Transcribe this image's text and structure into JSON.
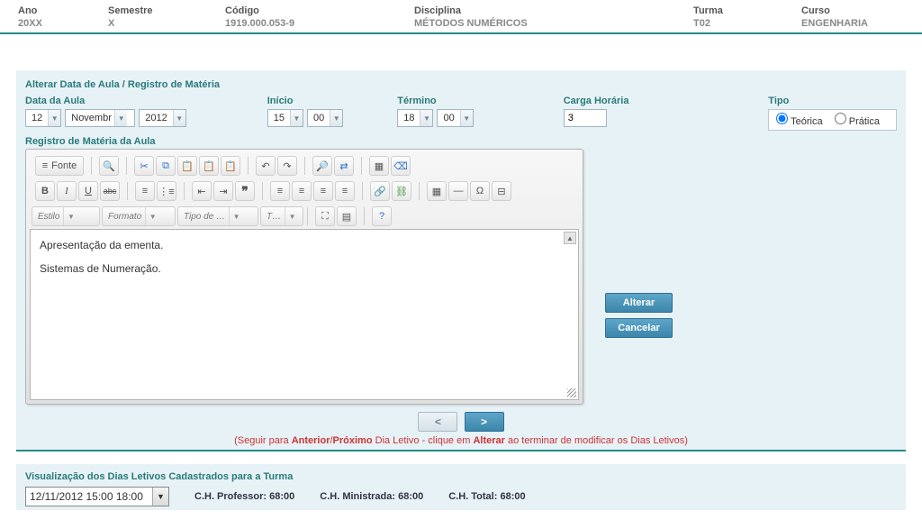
{
  "header": {
    "cols": [
      {
        "label": "Ano",
        "value": "20XX"
      },
      {
        "label": "Semestre",
        "value": "X"
      },
      {
        "label": "Código",
        "value": "1919.000.053-9"
      },
      {
        "label": "Disciplina",
        "value": "MÉTODOS NUMÉRICOS"
      },
      {
        "label": "Turma",
        "value": "T02"
      },
      {
        "label": "Curso",
        "value": "ENGENHARIA"
      }
    ]
  },
  "form": {
    "title": "Alterar Data de Aula / Registro de Matéria",
    "data_aula_label": "Data da Aula",
    "data_aula": {
      "dia": "12",
      "mes": "Novembr",
      "ano": "2012"
    },
    "inicio_label": "Início",
    "inicio": {
      "h": "15",
      "m": "00"
    },
    "termino_label": "Término",
    "termino": {
      "h": "18",
      "m": "00"
    },
    "carga_label": "Carga Horária",
    "carga_value": "3",
    "tipo_label": "Tipo",
    "tipo_teorica": "Teórica",
    "tipo_pratica": "Prática"
  },
  "editor": {
    "section_label": "Registro de Matéria da Aula",
    "source_btn": "Fonte",
    "style_combo": "Estilo",
    "format_combo": "Formato",
    "font_combo": "Tipo de …",
    "size_combo": "T…",
    "content_line1": "Apresentação da ementa.",
    "content_line2": "Sistemas de Numeração."
  },
  "actions": {
    "alterar": "Alterar",
    "cancelar": "Cancelar",
    "prev": "<",
    "next": ">",
    "hint_pre": "(Seguir para ",
    "hint_ant": "Anterior",
    "hint_sep": "/",
    "hint_prox": "Próximo",
    "hint_mid": " Dia Letivo - clique em ",
    "hint_alt": "Alterar",
    "hint_post": " ao terminar de modificar os Dias Letivos)"
  },
  "viz": {
    "title": "Visualização dos Dias Letivos Cadastrados para a Turma",
    "selected": "12/11/2012 15:00 18:00",
    "prof_label": "C.H. Professor: ",
    "prof_val": "68:00",
    "min_label": "C.H. Ministrada: ",
    "min_val": "68:00",
    "tot_label": "C.H. Total: ",
    "tot_val": "68:00"
  }
}
